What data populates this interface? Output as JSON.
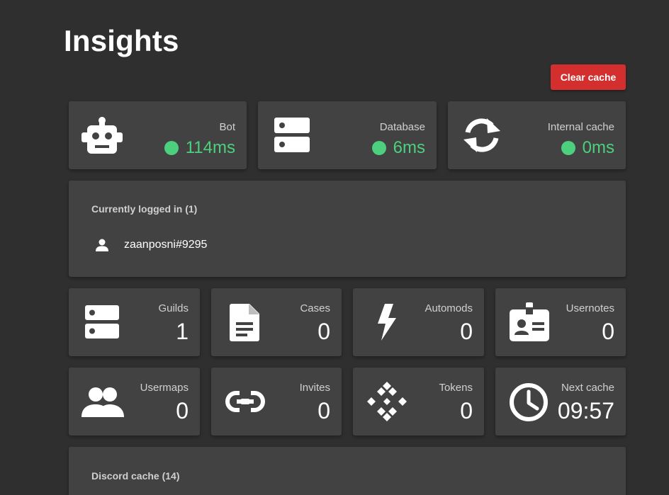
{
  "page": {
    "title": "Insights"
  },
  "actions": {
    "clear_cache_label": "Clear cache"
  },
  "latency_cards": [
    {
      "label": "Bot",
      "value": "114ms",
      "icon": "robot-icon",
      "status_color": "#4cd07d"
    },
    {
      "label": "Database",
      "value": "6ms",
      "icon": "server-icon",
      "status_color": "#4cd07d"
    },
    {
      "label": "Internal cache",
      "value": "0ms",
      "icon": "sync-icon",
      "status_color": "#4cd07d"
    }
  ],
  "logged_in": {
    "title": "Currently logged in (1)",
    "users": [
      {
        "name": "zaanposni#9295",
        "icon": "person-icon"
      }
    ]
  },
  "stats": [
    {
      "label": "Guilds",
      "value": "1",
      "icon": "server-icon"
    },
    {
      "label": "Cases",
      "value": "0",
      "icon": "document-icon"
    },
    {
      "label": "Automods",
      "value": "0",
      "icon": "bolt-icon"
    },
    {
      "label": "Usernotes",
      "value": "0",
      "icon": "id-badge-icon"
    },
    {
      "label": "Usermaps",
      "value": "0",
      "icon": "people-icon"
    },
    {
      "label": "Invites",
      "value": "0",
      "icon": "link-icon"
    },
    {
      "label": "Tokens",
      "value": "0",
      "icon": "token-icon"
    },
    {
      "label": "Next cache",
      "value": "09:57",
      "icon": "clock-icon"
    }
  ],
  "discord_cache": {
    "title": "Discord cache (14)"
  },
  "colors": {
    "background": "#2f2f2f",
    "card": "#424242",
    "accent_red": "#d32f2f",
    "status_green": "#4cd07d"
  }
}
